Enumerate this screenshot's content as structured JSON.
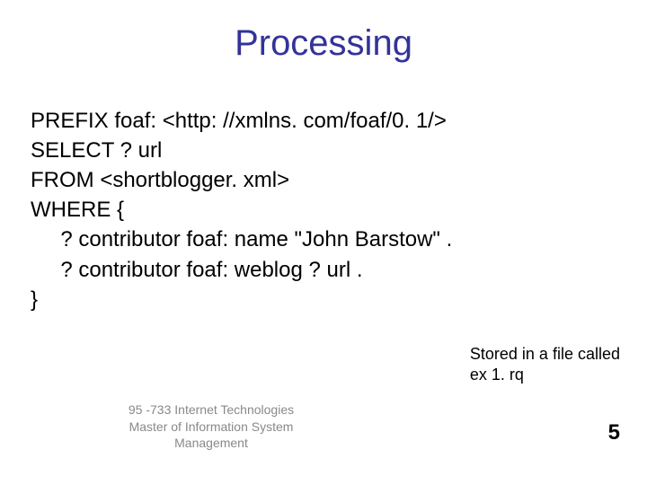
{
  "title": "Processing",
  "code": {
    "l1": "PREFIX foaf: <http: //xmlns. com/foaf/0. 1/>",
    "l2": "SELECT ? url",
    "l3": "FROM <shortblogger. xml>",
    "l4": "WHERE {",
    "l5": "     ? contributor foaf: name \"John Barstow\" .",
    "l6": "     ? contributor foaf: weblog ? url .",
    "l7": "}"
  },
  "note": {
    "l1": "Stored in a file called",
    "l2": "ex 1. rq"
  },
  "footer": {
    "l1": "95 -733 Internet Technologies",
    "l2": "Master of Information System",
    "l3": "Management"
  },
  "page_number": "5"
}
